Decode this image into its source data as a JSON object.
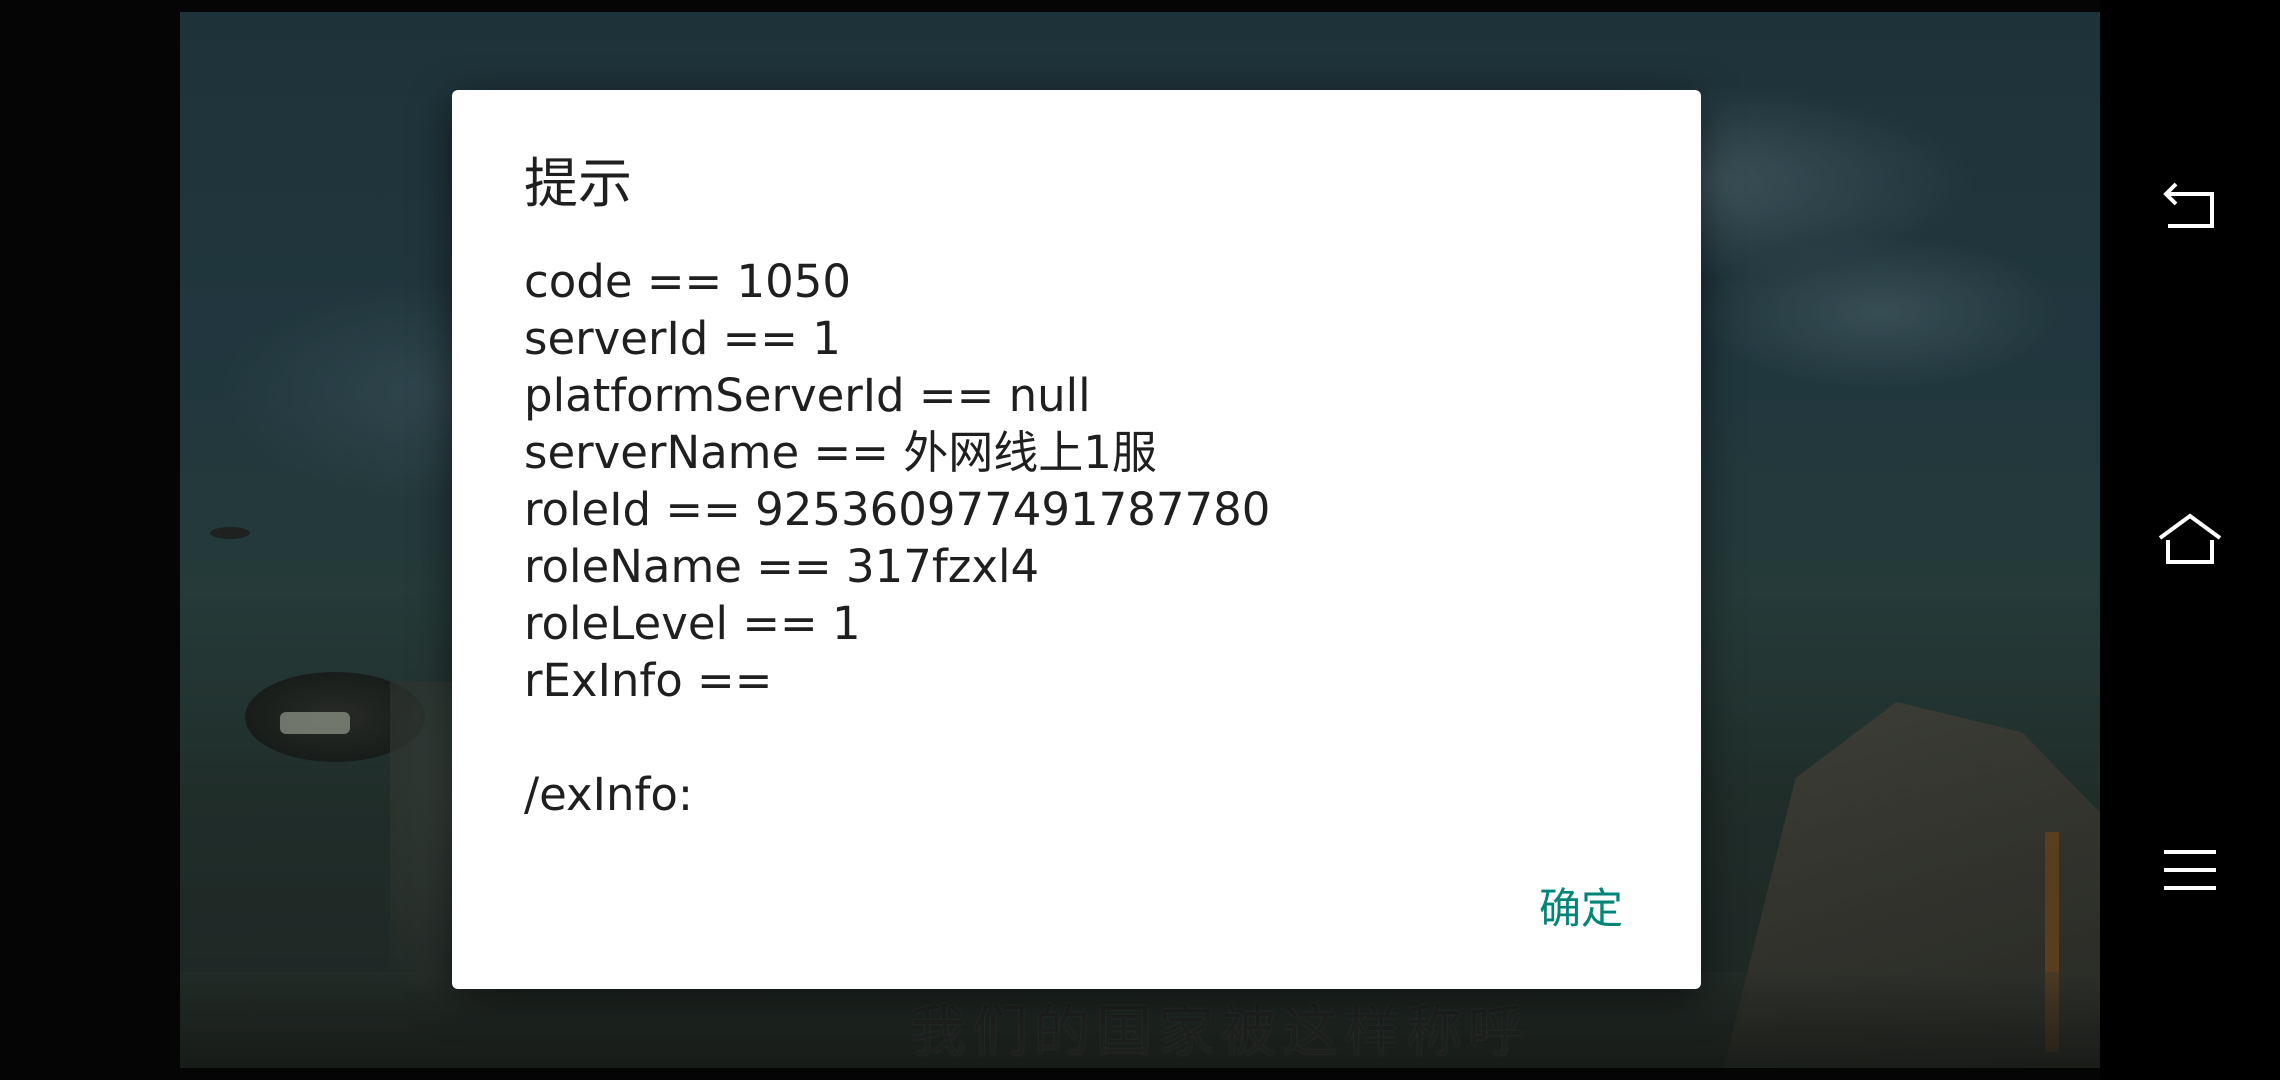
{
  "dialog": {
    "title": "提示",
    "lines": [
      "code == 1050",
      "serverId == 1",
      "platformServerId == null",
      "serverName == 外网线上1服",
      "roleId == 925360977491787780",
      "roleName == 317fzxl4",
      "roleLevel == 1",
      "rExInfo ==",
      "",
      "/exInfo:"
    ],
    "confirm_label": "确定"
  },
  "background": {
    "subtitle": "我们的国家被这样称呼"
  },
  "navigation": {
    "icons": [
      "back-icon",
      "home-icon",
      "menu-icon"
    ]
  },
  "colors": {
    "accent": "#008577",
    "dialog_bg": "#ffffff",
    "text": "#1f1f1f",
    "navbar_bg": "#000000"
  }
}
